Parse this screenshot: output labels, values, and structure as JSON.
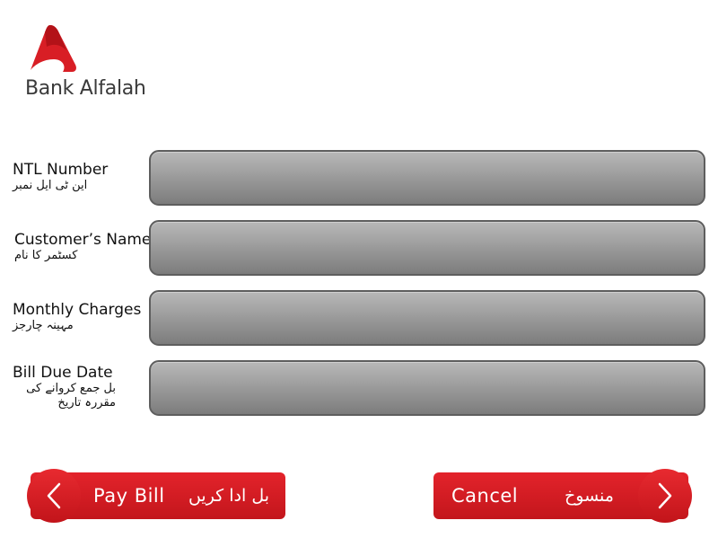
{
  "brand": {
    "name": "Bank Alfalah",
    "color": "#e02128"
  },
  "form": {
    "fields": [
      {
        "label_en": "NTL Number",
        "label_ur": "این ٹی ایل نمبر",
        "value": ""
      },
      {
        "label_en": "Customer’s Name",
        "label_ur": "کسٹمر کا نام",
        "value": ""
      },
      {
        "label_en": "Monthly Charges",
        "label_ur": "مہینہ چارجز",
        "value": ""
      },
      {
        "label_en": "Bill Due Date",
        "label_ur": "بل جمع کروانے کی مقررہ تاریخ",
        "value": ""
      }
    ]
  },
  "actions": {
    "pay": {
      "label_en": "Pay Bill",
      "label_ur": "بل ادا کریں",
      "icon": "chevron-left-icon"
    },
    "cancel": {
      "label_en": "Cancel",
      "label_ur": "منسوخ",
      "icon": "chevron-right-icon"
    }
  },
  "colors": {
    "button_red": "#d81e25",
    "field_gray": "#9d9d9d",
    "field_border": "#5e5e5e"
  }
}
